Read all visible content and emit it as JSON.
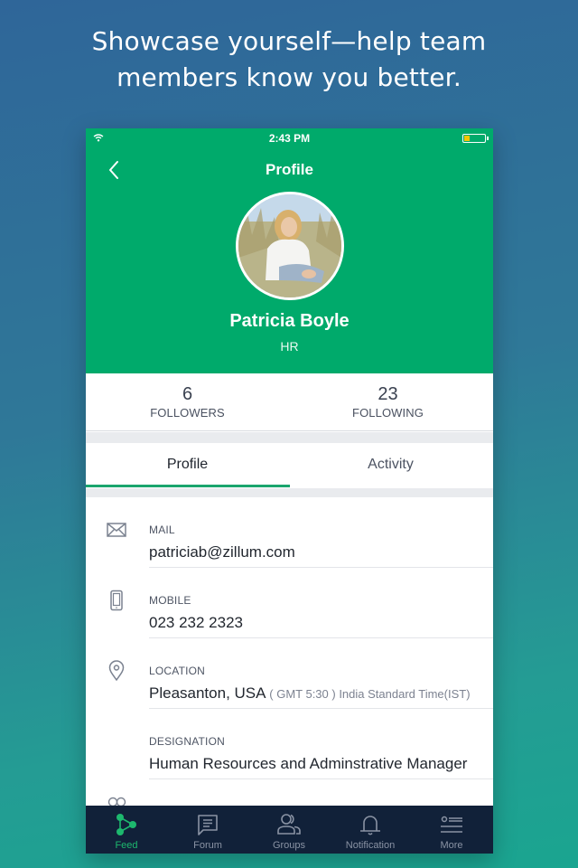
{
  "headline": {
    "line1": "Showcase yourself—help team",
    "line2": "members know you better."
  },
  "status_bar": {
    "time": "2:43 PM",
    "battery_level": 0.25,
    "battery_color": "#f5c400"
  },
  "nav": {
    "title": "Profile",
    "back_icon": "chevron-left-icon"
  },
  "profile": {
    "name": "Patricia Boyle",
    "department": "HR",
    "avatar_alt": "Profile photo of Patricia Boyle"
  },
  "stats": {
    "followers": {
      "count": "6",
      "label": "FOLLOWERS"
    },
    "following": {
      "count": "23",
      "label": "FOLLOWING"
    }
  },
  "tabs": [
    {
      "label": "Profile",
      "active": true
    },
    {
      "label": "Activity",
      "active": false
    }
  ],
  "details": [
    {
      "icon": "mail-icon",
      "label": "MAIL",
      "value": "patriciab@zillum.com"
    },
    {
      "icon": "mobile-phone-icon",
      "label": "MOBILE",
      "value": "023 232 2323"
    },
    {
      "icon": "location-pin-icon",
      "label": "LOCATION",
      "value": "Pleasanton, USA",
      "sub": "( GMT 5:30 ) India Standard Time(IST)"
    },
    {
      "icon": "",
      "label": "DESIGNATION",
      "value": "Human Resources and Adminstrative Manager"
    }
  ],
  "tabbar": [
    {
      "icon": "feed-icon",
      "label": "Feed",
      "active": true
    },
    {
      "icon": "forum-icon",
      "label": "Forum",
      "active": false
    },
    {
      "icon": "groups-icon",
      "label": "Groups",
      "active": false
    },
    {
      "icon": "notification-bell-icon",
      "label": "Notification",
      "active": false
    },
    {
      "icon": "more-menu-icon",
      "label": "More",
      "active": false
    }
  ],
  "colors": {
    "header_green": "#00aa6b",
    "accent_green": "#1aa56e",
    "tabbar_bg": "#112139"
  }
}
